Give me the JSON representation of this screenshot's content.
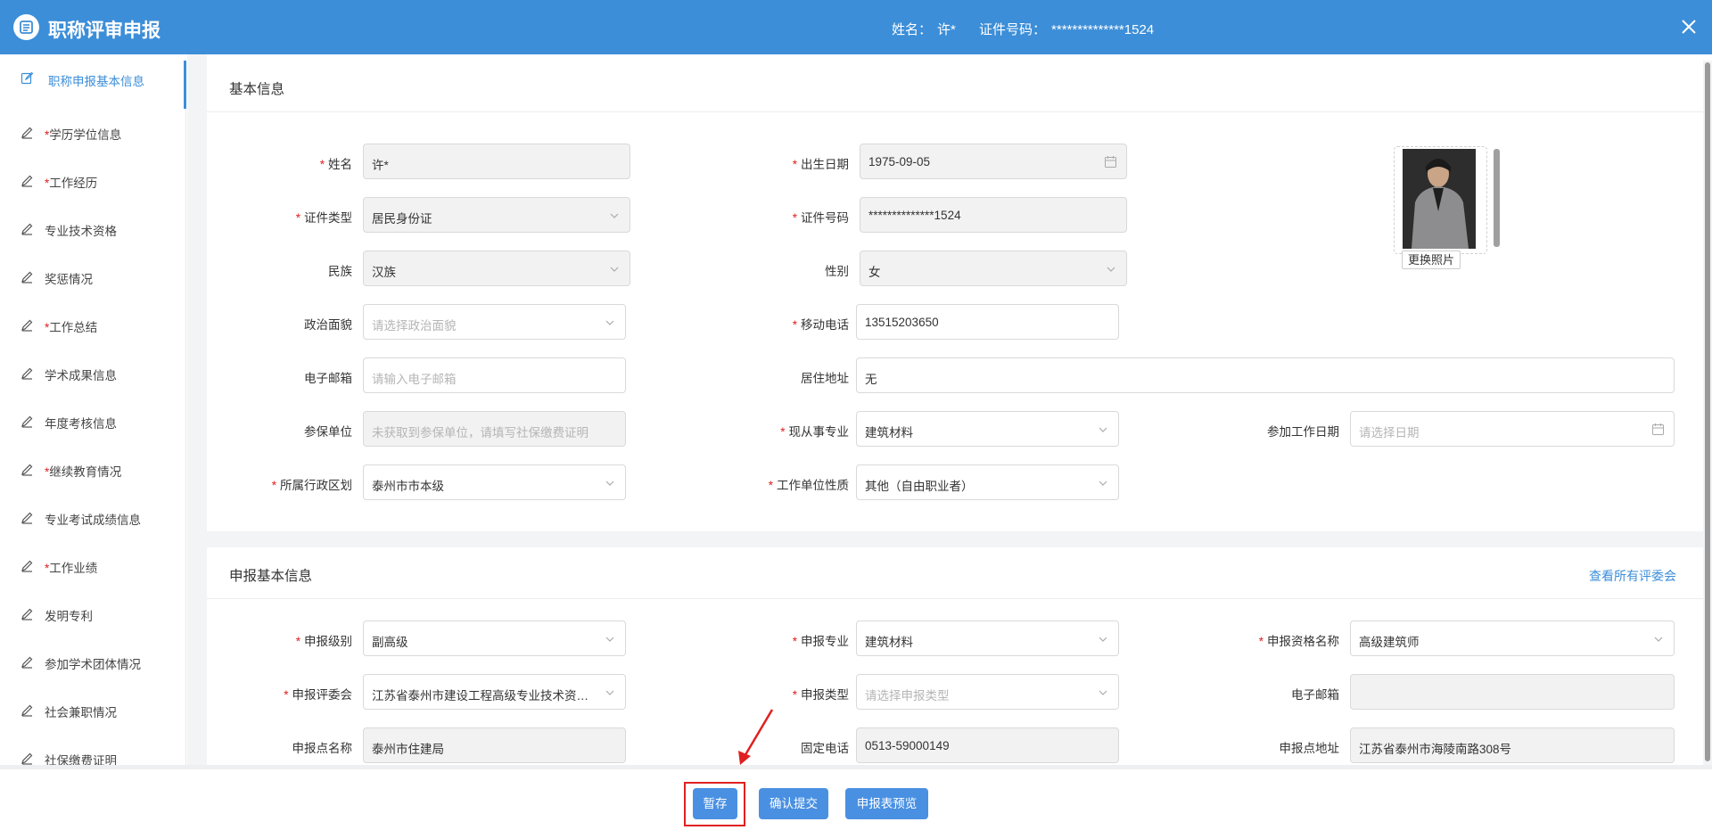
{
  "header": {
    "title": "职称评审申报",
    "name_label": "姓名：",
    "name_value": "许*",
    "id_label": "证件号码：",
    "id_value": "**************1524"
  },
  "sidebar": {
    "items": [
      {
        "label": "职称申报基本信息",
        "required": false,
        "active": true
      },
      {
        "label": "学历学位信息",
        "required": true
      },
      {
        "label": "工作经历",
        "required": true
      },
      {
        "label": "专业技术资格",
        "required": false
      },
      {
        "label": "奖惩情况",
        "required": false
      },
      {
        "label": "工作总结",
        "required": true
      },
      {
        "label": "学术成果信息",
        "required": false
      },
      {
        "label": "年度考核信息",
        "required": false
      },
      {
        "label": "继续教育情况",
        "required": true
      },
      {
        "label": "专业考试成绩信息",
        "required": false
      },
      {
        "label": "工作业绩",
        "required": true
      },
      {
        "label": "发明专利",
        "required": false
      },
      {
        "label": "参加学术团体情况",
        "required": false
      },
      {
        "label": "社会兼职情况",
        "required": false
      },
      {
        "label": "社保缴费证明",
        "required": false
      }
    ]
  },
  "basic": {
    "section_title": "基本信息",
    "name": {
      "label": "姓名",
      "value": "许*"
    },
    "birth": {
      "label": "出生日期",
      "value": "1975-09-05"
    },
    "id_type": {
      "label": "证件类型",
      "value": "居民身份证"
    },
    "id_no": {
      "label": "证件号码",
      "value": "**************1524"
    },
    "ethnic": {
      "label": "民族",
      "value": "汉族"
    },
    "gender": {
      "label": "性别",
      "value": "女"
    },
    "political": {
      "label": "政治面貌",
      "placeholder": "请选择政治面貌"
    },
    "mobile": {
      "label": "移动电话",
      "value": "13515203650"
    },
    "email": {
      "label": "电子邮箱",
      "placeholder": "请输入电子邮箱"
    },
    "address": {
      "label": "居住地址",
      "value": "无"
    },
    "insured_unit": {
      "label": "参保单位",
      "placeholder": "未获取到参保单位，请填写社保缴费证明"
    },
    "major": {
      "label": "现从事专业",
      "value": "建筑材料"
    },
    "work_start": {
      "label": "参加工作日期",
      "placeholder": "请选择日期"
    },
    "region": {
      "label": "所属行政区划",
      "value": "泰州市市本级"
    },
    "unit_nature": {
      "label": "工作单位性质",
      "value": "其他（自由职业者）"
    },
    "photo_button": "更换照片"
  },
  "apply": {
    "section_title": "申报基本信息",
    "view_link": "查看所有评委会",
    "level": {
      "label": "申报级别",
      "value": "副高级"
    },
    "major": {
      "label": "申报专业",
      "value": "建筑材料"
    },
    "qual_name": {
      "label": "申报资格名称",
      "value": "高级建筑师"
    },
    "committee": {
      "label": "申报评委会",
      "value": "江苏省泰州市建设工程高级专业技术资格（副高）评审委员会"
    },
    "type": {
      "label": "申报类型",
      "placeholder": "请选择申报类型"
    },
    "email": {
      "label": "电子邮箱",
      "value": ""
    },
    "point_name": {
      "label": "申报点名称",
      "value": "泰州市住建局"
    },
    "phone": {
      "label": "固定电话",
      "value": "0513-59000149"
    },
    "point_addr": {
      "label": "申报点地址",
      "value": "江苏省泰州市海陵南路308号"
    }
  },
  "footer": {
    "save": "暂存",
    "submit": "确认提交",
    "preview": "申报表预览"
  },
  "colors": {
    "accent": "#3c8ed8",
    "required": "#e02020",
    "annotation": "#e02020"
  }
}
